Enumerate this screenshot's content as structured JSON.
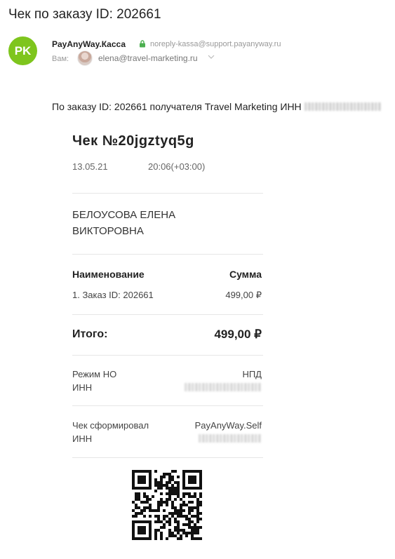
{
  "email": {
    "subject": "Чек по заказу ID: 202661",
    "sender": {
      "initials": "PK",
      "name": "PayAnyWay.Касса",
      "email": "noreply-kassa@support.payanyway.ru",
      "lock_icon": "lock-icon"
    },
    "recipient": {
      "label": "Вам:",
      "email": "elena@travel-marketing.ru",
      "expand_icon": "chevron-down-icon"
    },
    "intro": "По заказу ID: 202661 получателя Travel Marketing ИНН"
  },
  "receipt": {
    "title": "Чек №20jgztyq5g",
    "date": "13.05.21",
    "time": "20:06(+03:00)",
    "customer": "БЕЛОУСОВА ЕЛЕНА ВИКТОРОВНА",
    "table_headers": {
      "name": "Наименование",
      "sum": "Сумма"
    },
    "items": [
      {
        "name": "1.  Заказ ID: 202661",
        "sum": "499,00 ₽"
      }
    ],
    "total": {
      "label": "Итого:",
      "sum": "499,00 ₽"
    },
    "tax": {
      "mode_label": "Режим НО",
      "mode_value": "НПД",
      "inn_label": "ИНН"
    },
    "issuer": {
      "label": "Чек сформировал",
      "value": "PayAnyWay.Self",
      "inn_label": "ИНН"
    }
  },
  "colors": {
    "avatar_bg": "#7ec51d",
    "lock": "#4caf50"
  }
}
